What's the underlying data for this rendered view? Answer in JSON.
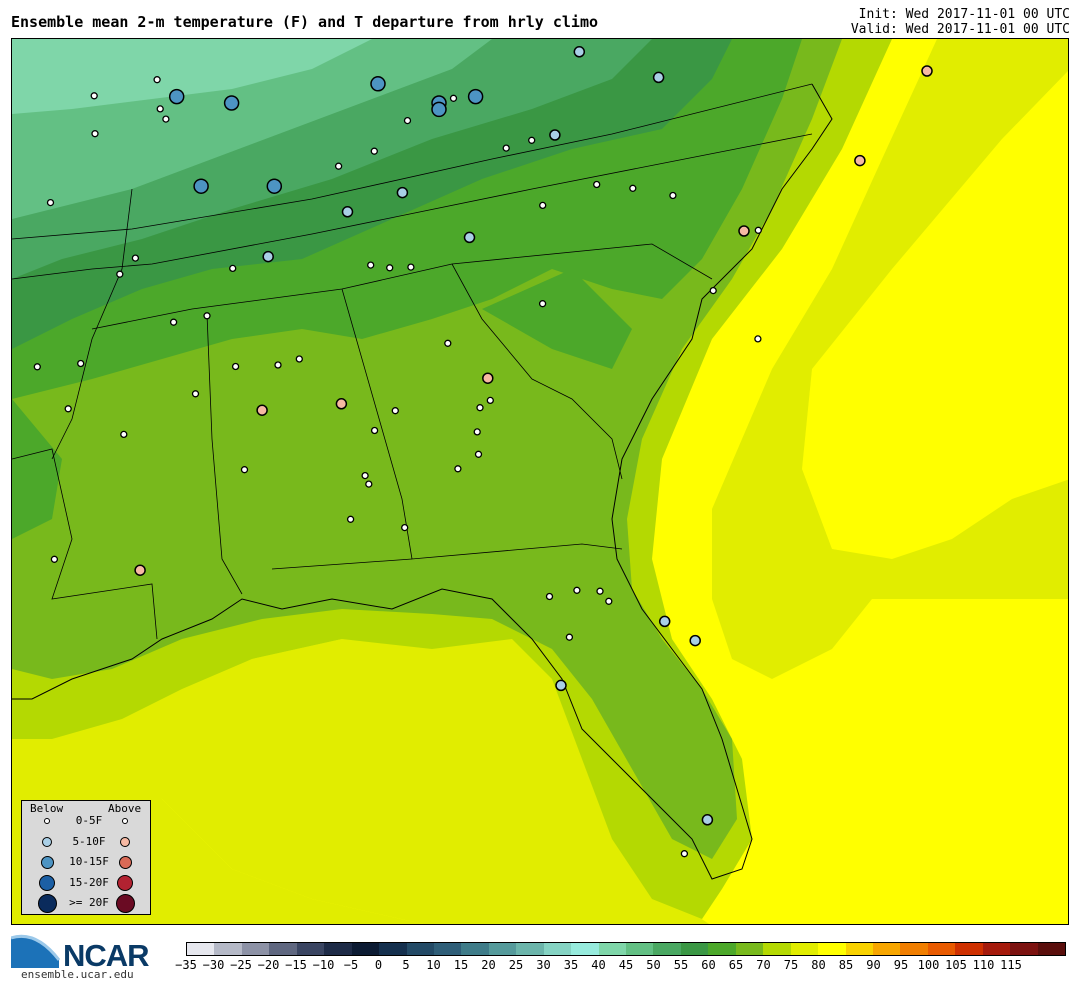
{
  "header": {
    "title": "Ensemble mean 2-m temperature (F) and T departure from hrly climo",
    "init": "Init: Wed 2017-11-01 00 UTC",
    "valid": "Valid: Wed 2017-11-01 00 UTC"
  },
  "legend": {
    "below_label": "Below",
    "above_label": "Above",
    "rows": [
      {
        "label": "0-5F",
        "below_color": "#ffffff",
        "above_color": "#ffffff"
      },
      {
        "label": "5-10F",
        "below_color": "#a9cfe6",
        "above_color": "#f6b9a3"
      },
      {
        "label": "10-15F",
        "below_color": "#4d94c3",
        "above_color": "#d96a56"
      },
      {
        "label": "15-20F",
        "below_color": "#1c5fa4",
        "above_color": "#b22231"
      },
      {
        "label": ">= 20F",
        "below_color": "#0a2b5c",
        "above_color": "#6a0b23"
      }
    ]
  },
  "branding": {
    "logo_text": "NCAR",
    "url": "ensemble.ucar.edu"
  },
  "colorbar": {
    "ticks": [
      "−35",
      "−30",
      "−25",
      "−20",
      "−15",
      "−10",
      "−5",
      "0",
      "5",
      "10",
      "15",
      "20",
      "25",
      "30",
      "35",
      "40",
      "45",
      "50",
      "55",
      "60",
      "65",
      "70",
      "75",
      "80",
      "85",
      "90",
      "95",
      "100",
      "105",
      "110",
      "115"
    ],
    "colors": [
      "#e6e7ee",
      "#b5b9c7",
      "#8d92a6",
      "#5f6780",
      "#3a4562",
      "#1e2b47",
      "#0c1b33",
      "#15304e",
      "#234a66",
      "#2f5e78",
      "#3f7c89",
      "#559a9b",
      "#6cb5ab",
      "#85d3c3",
      "#97ebdd",
      "#7fd6a9",
      "#63c084",
      "#4aa862",
      "#3a9744",
      "#4ca82a",
      "#78b91c",
      "#b4d902",
      "#e1ed00",
      "#ffff00",
      "#f9d200",
      "#f7a600",
      "#f07e00",
      "#e85a00",
      "#cf3000",
      "#a51a0c",
      "#7c1210",
      "#5a0e0c"
    ]
  },
  "map": {
    "region": "Southeast United States",
    "stations": [
      {
        "lon": -87.9,
        "lat": 37.0,
        "cat": "b2"
      },
      {
        "lon": -85.5,
        "lat": 37.3,
        "cat": "b2"
      },
      {
        "lon": -84.5,
        "lat": 37.0,
        "cat": "b2"
      },
      {
        "lon": -83.9,
        "lat": 37.1,
        "cat": "b2"
      },
      {
        "lon": -88.4,
        "lat": 35.7,
        "cat": "b2"
      },
      {
        "lon": -87.2,
        "lat": 35.7,
        "cat": "b2"
      },
      {
        "lon": -88.8,
        "lat": 37.1,
        "cat": "b2"
      },
      {
        "lon": -84.5,
        "lat": 36.9,
        "cat": "b2"
      },
      {
        "lon": -82.2,
        "lat": 37.8,
        "cat": "b1"
      },
      {
        "lon": -80.9,
        "lat": 37.4,
        "cat": "b1"
      },
      {
        "lon": -82.6,
        "lat": 36.5,
        "cat": "b1"
      },
      {
        "lon": -85.1,
        "lat": 35.6,
        "cat": "b1"
      },
      {
        "lon": -86.0,
        "lat": 35.3,
        "cat": "b1"
      },
      {
        "lon": -84.0,
        "lat": 34.9,
        "cat": "b1"
      },
      {
        "lon": -87.3,
        "lat": 34.6,
        "cat": "b1"
      },
      {
        "lon": -80.3,
        "lat": 28.6,
        "cat": "b1"
      },
      {
        "lon": -80.8,
        "lat": 28.9,
        "cat": "b1"
      },
      {
        "lon": -82.5,
        "lat": 27.9,
        "cat": "b1"
      },
      {
        "lon": -80.1,
        "lat": 25.8,
        "cat": "b1"
      },
      {
        "lon": -76.5,
        "lat": 37.5,
        "cat": "a1"
      },
      {
        "lon": -77.6,
        "lat": 36.1,
        "cat": "a1"
      },
      {
        "lon": -79.5,
        "lat": 35.0,
        "cat": "a1"
      },
      {
        "lon": -83.7,
        "lat": 32.7,
        "cat": "a1"
      },
      {
        "lon": -86.1,
        "lat": 32.3,
        "cat": "a1"
      },
      {
        "lon": -87.4,
        "lat": 32.2,
        "cat": "a1"
      },
      {
        "lon": -89.4,
        "lat": 29.7,
        "cat": "a1"
      }
    ],
    "small_station_count": 78
  }
}
